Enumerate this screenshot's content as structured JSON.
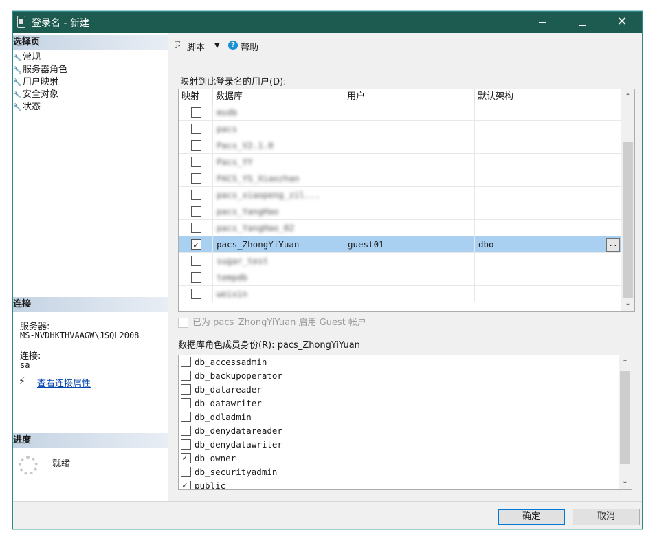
{
  "window": {
    "title": "登录名 - 新建",
    "min_glyph": "",
    "max_glyph": "",
    "close_glyph": "✕"
  },
  "left": {
    "select_page_header": "选择页",
    "nav_items": [
      {
        "label": "常规"
      },
      {
        "label": "服务器角色"
      },
      {
        "label": "用户映射"
      },
      {
        "label": "安全对象"
      },
      {
        "label": "状态"
      }
    ],
    "connection_header": "连接",
    "server_label": "服务器:",
    "server_value": "MS-NVDHKTHVAAGW\\JSQL2008",
    "connection_label": "连接:",
    "connection_value": "sa",
    "view_conn_props": "查看连接属性",
    "progress_header": "进度",
    "progress_status": "就绪"
  },
  "toolbar": {
    "script_label": "脚本",
    "help_label": "帮助"
  },
  "mapping": {
    "label": "映射到此登录名的用户(D):",
    "columns": [
      "映射",
      "数据库",
      "用户",
      "默认架构"
    ],
    "rows": [
      {
        "checked": false,
        "db": "msdb",
        "blurred": true,
        "user": "",
        "schema": ""
      },
      {
        "checked": false,
        "db": "pacs",
        "blurred": true,
        "user": "",
        "schema": ""
      },
      {
        "checked": false,
        "db": "Pacs_V2.1.0",
        "blurred": true,
        "user": "",
        "schema": ""
      },
      {
        "checked": false,
        "db": "Pacs_YY",
        "blurred": true,
        "user": "",
        "schema": ""
      },
      {
        "checked": false,
        "db": "PACS_YS_Xiaozhan",
        "blurred": true,
        "user": "",
        "schema": ""
      },
      {
        "checked": false,
        "db": "pacs_xiaopeng_zil...",
        "blurred": true,
        "user": "",
        "schema": ""
      },
      {
        "checked": false,
        "db": "pacs_YangHao",
        "blurred": true,
        "user": "",
        "schema": ""
      },
      {
        "checked": false,
        "db": "pacs_YangHao_02",
        "blurred": true,
        "user": "",
        "schema": ""
      },
      {
        "checked": true,
        "db": "pacs_ZhongYiYuan",
        "blurred": false,
        "user": "guest01",
        "schema": "dbo",
        "selected": true
      },
      {
        "checked": false,
        "db": "sugar_test",
        "blurred": true,
        "user": "",
        "schema": ""
      },
      {
        "checked": false,
        "db": "tempdb",
        "blurred": true,
        "user": "",
        "schema": ""
      },
      {
        "checked": false,
        "db": "weixin",
        "blurred": true,
        "user": "",
        "schema": ""
      }
    ],
    "ellipsis": ".."
  },
  "guest": {
    "text": "已为 pacs_ZhongYiYuan 启用 Guest 帐户"
  },
  "roles": {
    "label": "数据库角色成员身份(R): pacs_ZhongYiYuan",
    "items": [
      {
        "name": "db_accessadmin",
        "checked": false
      },
      {
        "name": "db_backupoperator",
        "checked": false
      },
      {
        "name": "db_datareader",
        "checked": false
      },
      {
        "name": "db_datawriter",
        "checked": false
      },
      {
        "name": "db_ddladmin",
        "checked": false
      },
      {
        "name": "db_denydatareader",
        "checked": false
      },
      {
        "name": "db_denydatawriter",
        "checked": false
      },
      {
        "name": "db_owner",
        "checked": true
      },
      {
        "name": "db_securityadmin",
        "checked": false
      },
      {
        "name": "public",
        "checked": true
      }
    ]
  },
  "footer": {
    "ok_label": "确定",
    "cancel_label": "取消"
  }
}
